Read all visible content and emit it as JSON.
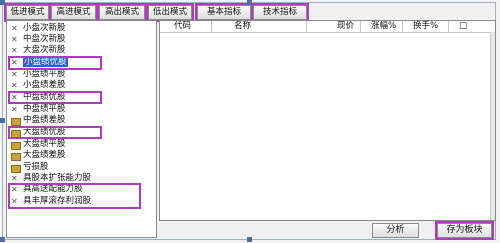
{
  "toolbar": {
    "tabs": [
      {
        "label": "低进模式"
      },
      {
        "label": "高进模式"
      },
      {
        "label": "高出模式"
      },
      {
        "label": "低出模式"
      },
      {
        "label": "基本指标"
      },
      {
        "label": "技术指标"
      }
    ]
  },
  "tree": {
    "items": [
      {
        "label": "小盘次新股",
        "icon": "x-icon"
      },
      {
        "label": "中盘次新股",
        "icon": "x-icon"
      },
      {
        "label": "大盘次新股",
        "icon": "x-icon"
      },
      {
        "label": "小盘绩优股",
        "icon": "x-icon"
      },
      {
        "label": "小盘绩平股",
        "icon": "x-icon"
      },
      {
        "label": "小盘绩差股",
        "icon": "x-icon"
      },
      {
        "label": "中盘绩优股",
        "icon": "x-icon"
      },
      {
        "label": "中盘绩平股",
        "icon": "x-icon"
      },
      {
        "label": "中盘绩差股",
        "icon": "folder-icon"
      },
      {
        "label": "大盘绩优股",
        "icon": "folder-icon"
      },
      {
        "label": "大盘绩平股",
        "icon": "folder-icon"
      },
      {
        "label": "大盘绩差股",
        "icon": "folder-icon"
      },
      {
        "label": "亏损股",
        "icon": "folder-icon"
      },
      {
        "label": "具股本扩张能力股",
        "icon": "x-icon"
      },
      {
        "label": "具高送配能力股",
        "icon": "x-icon"
      },
      {
        "label": "具丰厚滚存利润股",
        "icon": "x-icon"
      }
    ]
  },
  "table": {
    "columns": [
      "代码",
      "名称",
      "现价",
      "涨幅%",
      "换手%",
      "□"
    ]
  },
  "buttons": {
    "analyze": "分析",
    "save_block": "存为板块"
  },
  "colors": {
    "highlight": "#b13bc0",
    "selected": "#2f62c9"
  }
}
